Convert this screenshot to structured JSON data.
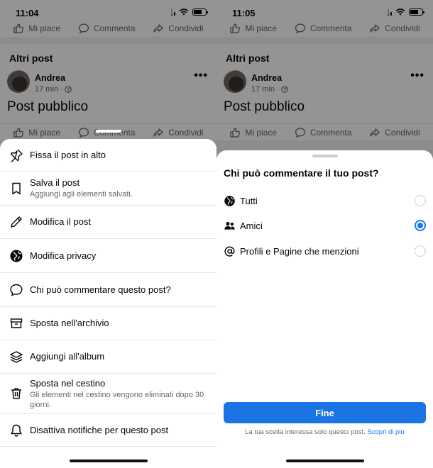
{
  "left": {
    "status_time": "11:04",
    "feed": {
      "top_actions": [
        "Mi piace",
        "Commenta",
        "Condividi"
      ],
      "section_title": "Altri post",
      "post": {
        "author": "Andrea",
        "time": "17 min",
        "text": "Post pubblico"
      },
      "bottom_actions": [
        "Mi piace",
        "Commenta",
        "Condividi"
      ]
    },
    "menu": [
      {
        "icon": "pin-icon",
        "label": "Fissa il post in alto"
      },
      {
        "icon": "bookmark-icon",
        "label": "Salva il post",
        "sub": "Aggiungi agli elementi salvati."
      },
      {
        "icon": "pencil-icon",
        "label": "Modifica il post"
      },
      {
        "icon": "globe-icon",
        "label": "Modifica privacy"
      },
      {
        "icon": "comment-icon",
        "label": "Chi può commentare questo post?"
      },
      {
        "icon": "archive-box-icon",
        "label": "Sposta nell'archivio"
      },
      {
        "icon": "album-stack-icon",
        "label": "Aggiungi all'album"
      },
      {
        "icon": "trash-icon",
        "label": "Sposta nel cestino",
        "sub": "Gli elementi nel cestino vengono eliminati dopo 30 giorni."
      },
      {
        "icon": "bell-icon",
        "label": "Disattiva notifiche per questo post"
      }
    ]
  },
  "right": {
    "status_time": "11:05",
    "feed": {
      "top_actions": [
        "Mi piace",
        "Commenta",
        "Condividi"
      ],
      "section_title": "Altri post",
      "post": {
        "author": "Andrea",
        "time": "17 min",
        "text": "Post pubblico"
      },
      "bottom_actions": [
        "Mi piace",
        "Commenta",
        "Condividi"
      ]
    },
    "sheet": {
      "title": "Chi può commentare il tuo post?",
      "options": [
        {
          "icon": "globe-icon",
          "label": "Tutti",
          "selected": false
        },
        {
          "icon": "friends-icon",
          "label": "Amici",
          "selected": true
        },
        {
          "icon": "at-sign-icon",
          "label": "Profili e Pagine che menzioni",
          "selected": false
        }
      ],
      "done_label": "Fine",
      "footnote": "La tua scelta interessa solo questo post.",
      "footnote_link": "Scopri di più"
    }
  },
  "colors": {
    "accent": "#1877f2",
    "button": "#1b74e4",
    "secondary_text": "#65676b",
    "divider": "#e4e6eb"
  }
}
